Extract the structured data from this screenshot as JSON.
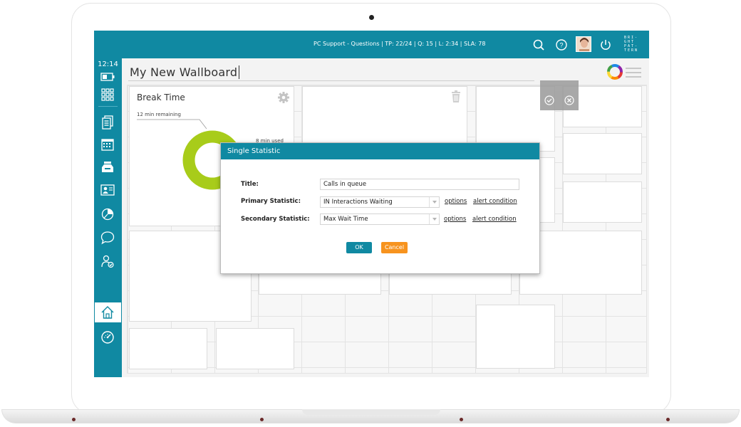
{
  "topbar": {
    "status_text": "PC Support - Questions | TP: 22/24 | Q: 15 | L: 2:34 | SLA: 78",
    "brand_lines": [
      "BRI-",
      "GHT",
      "PAT-",
      "TERN"
    ]
  },
  "sidebar": {
    "clock": "12:14",
    "icons": [
      "battery-icon",
      "apps-grid-icon",
      "documents-icon",
      "calendar-icon",
      "inbox-tray-icon",
      "contact-card-icon",
      "pie-chart-icon",
      "chat-bubble-icon",
      "user-check-icon",
      "home-icon",
      "speedometer-icon"
    ],
    "active": "home-icon"
  },
  "wallboard": {
    "title": "My New Wallboard"
  },
  "break_time_tile": {
    "title": "Break Time",
    "remaining": "12 min remaining",
    "used": "8 min used",
    "used_fraction": 0.4
  },
  "dialog": {
    "title": "Single Statistic",
    "title_label": "Title:",
    "title_value": "Calls in queue",
    "primary_label": "Primary Statistic:",
    "primary_value": "IN Interactions Waiting",
    "secondary_label": "Secondary Statistic:",
    "secondary_value": "Max Wait Time",
    "options_label": "options",
    "alert_label": "alert condition",
    "ok_label": "OK",
    "cancel_label": "Cancel"
  },
  "colors": {
    "teal": "#1089a2",
    "donut_green": "#a8cc1a",
    "cancel_orange": "#f7931e"
  }
}
